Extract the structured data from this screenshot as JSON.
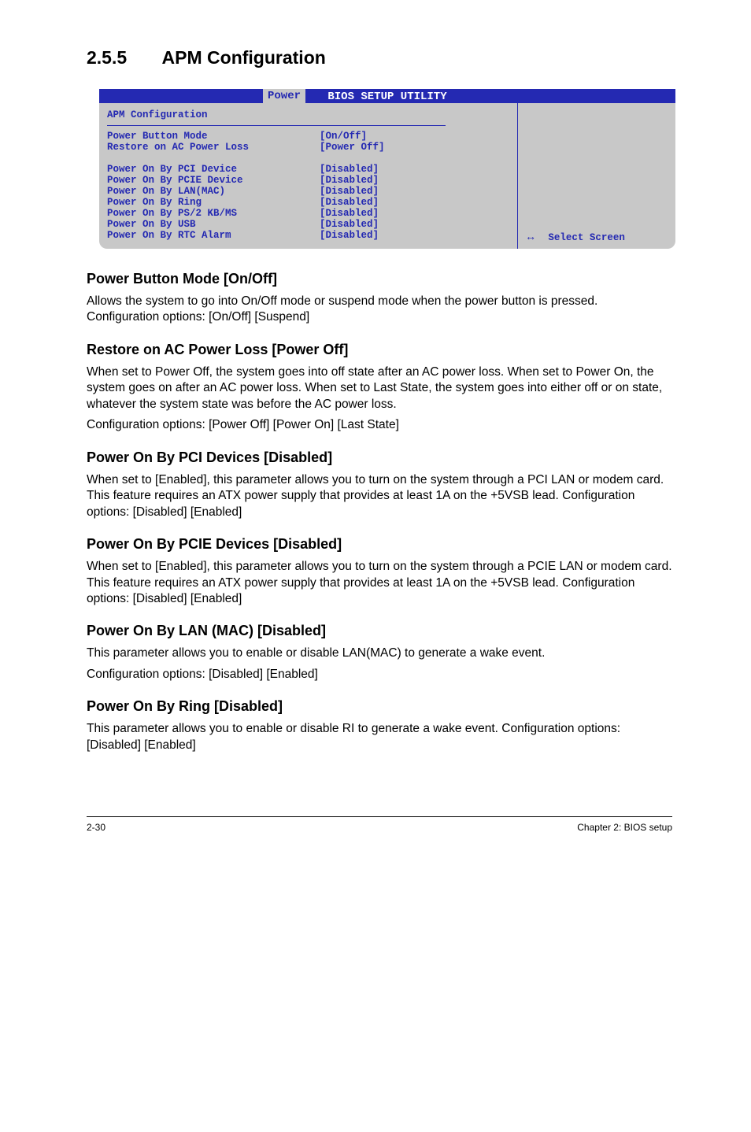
{
  "section": {
    "number": "2.5.5",
    "title": "APM Configuration"
  },
  "bios": {
    "header": "BIOS SETUP UTILITY",
    "tab": "Power",
    "panel_title": "APM Configuration",
    "rows_top": [
      {
        "label": "Power Button Mode",
        "value": "[On/Off]"
      },
      {
        "label": "Restore on AC Power Loss",
        "value": "[Power Off]"
      }
    ],
    "rows_bottom": [
      {
        "label": "Power On By PCI Device",
        "value": "[Disabled]"
      },
      {
        "label": "Power On By PCIE Device",
        "value": "[Disabled]"
      },
      {
        "label": "Power On By LAN(MAC)",
        "value": "[Disabled]"
      },
      {
        "label": "Power On By Ring",
        "value": "[Disabled]"
      },
      {
        "label": "Power On By PS/2 KB/MS",
        "value": "[Disabled]"
      },
      {
        "label": "Power On By USB",
        "value": "[Disabled]"
      },
      {
        "label": "Power On By RTC Alarm",
        "value": "[Disabled]"
      }
    ],
    "right_arrow": "↔",
    "right_label": "Select Screen"
  },
  "content": {
    "h1": "Power Button Mode [On/Off]",
    "p1": "Allows the system to go into On/Off mode or suspend mode when the power button is pressed. Configuration options: [On/Off] [Suspend]",
    "h2": "Restore on AC Power Loss [Power Off]",
    "p2a": "When set to Power Off, the system goes into off state after an AC power loss. When set to Power On, the system goes on after an AC power loss. When set to Last State, the system goes into either off or on state, whatever the system state was before the AC power loss.",
    "p2b": "Configuration options: [Power Off] [Power On] [Last State]",
    "h3": "Power On By PCI Devices [Disabled]",
    "p3": "When set to [Enabled], this parameter allows you to turn on the system through a PCI LAN or modem card. This feature requires an ATX power supply that provides at least 1A on the +5VSB lead. Configuration options: [Disabled] [Enabled]",
    "h4": "Power On By PCIE Devices [Disabled]",
    "p4": "When set to [Enabled], this parameter allows you to turn on the system through a PCIE LAN or modem card. This feature requires an ATX power supply that provides at least 1A on the +5VSB lead. Configuration options: [Disabled] [Enabled]",
    "h5": "Power On By LAN (MAC) [Disabled]",
    "p5a": "This parameter allows you to enable or disable LAN(MAC) to generate a wake event.",
    "p5b": "Configuration options: [Disabled] [Enabled]",
    "h6": "Power On By Ring [Disabled]",
    "p6": "This parameter allows you to enable or disable RI to generate a wake event. Configuration options: [Disabled] [Enabled]"
  },
  "footer": {
    "left": "2-30",
    "right": "Chapter 2: BIOS setup"
  }
}
